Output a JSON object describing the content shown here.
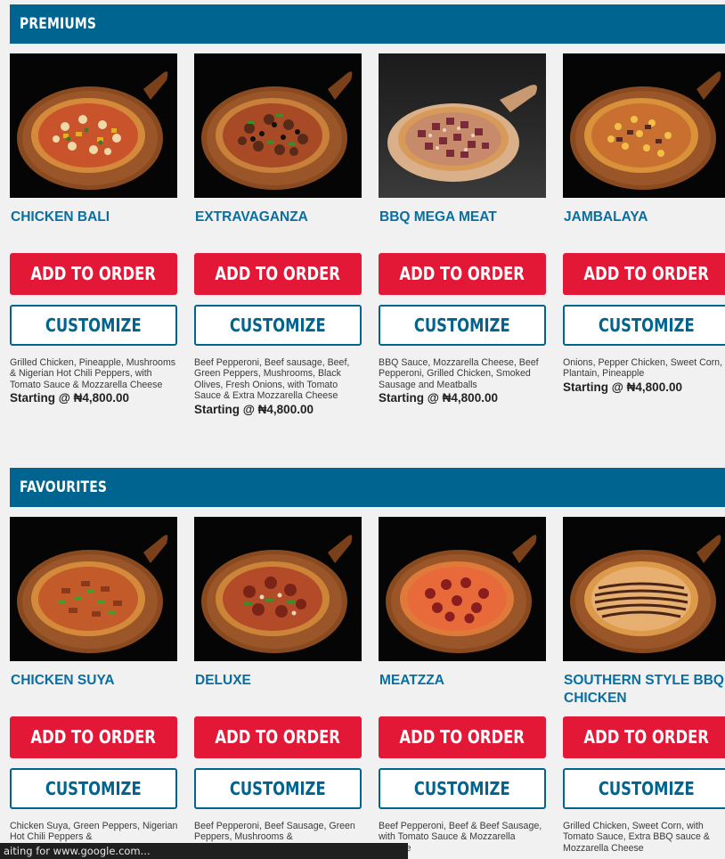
{
  "sections": [
    {
      "title": "PREMIUMS",
      "items": [
        {
          "name": "CHICKEN BALI",
          "add_label": "ADD TO ORDER",
          "customize_label": "CUSTOMIZE",
          "description": "Grilled Chicken, Pineapple, Mushrooms & Nigerian Hot Chili Peppers, with Tomato Sauce & Mozzarella Cheese",
          "price": "Starting @ ₦4,800.00"
        },
        {
          "name": "EXTRAVAGANZA",
          "add_label": "ADD TO ORDER",
          "customize_label": "CUSTOMIZE",
          "description": "Beef Pepperoni, Beef sausage, Beef, Green Peppers, Mushrooms, Black Olives, Fresh Onions, with Tomato Sauce & Extra Mozzarella Cheese",
          "price": "Starting @ ₦4,800.00"
        },
        {
          "name": "BBQ MEGA MEAT",
          "add_label": "ADD TO ORDER",
          "customize_label": "CUSTOMIZE",
          "description": "BBQ Sauce, Mozzarella Cheese, Beef Pepperoni, Grilled Chicken, Smoked Sausage and Meatballs",
          "price": "Starting @ ₦4,800.00"
        },
        {
          "name": "JAMBALAYA",
          "add_label": "ADD TO ORDER",
          "customize_label": "CUSTOMIZE",
          "description": "Onions, Pepper Chicken, Sweet Corn, Plantain, Pineapple",
          "price": "Starting @ ₦4,800.00"
        }
      ]
    },
    {
      "title": "FAVOURITES",
      "items": [
        {
          "name": "CHICKEN SUYA",
          "add_label": "ADD TO ORDER",
          "customize_label": "CUSTOMIZE",
          "description": "Chicken Suya, Green Peppers, Nigerian Hot Chili Peppers &",
          "price": ""
        },
        {
          "name": "DELUXE",
          "add_label": "ADD TO ORDER",
          "customize_label": "CUSTOMIZE",
          "description": "Beef Pepperoni, Beef Sausage, Green Peppers, Mushrooms &",
          "price": ""
        },
        {
          "name": "MEATZZA",
          "add_label": "ADD TO ORDER",
          "customize_label": "CUSTOMIZE",
          "description": "Beef Pepperoni, Beef & Beef Sausage, with Tomato Sauce & Mozzarella Cheese",
          "price": ""
        },
        {
          "name": "SOUTHERN STYLE BBQ CHICKEN",
          "add_label": "ADD TO ORDER",
          "customize_label": "CUSTOMIZE",
          "description": "Grilled Chicken, Sweet Corn, with Tomato Sauce, Extra BBQ sauce & Mozzarella Cheese",
          "price": ""
        }
      ]
    }
  ],
  "status_bar": {
    "text": "aiting for www.google.com..."
  },
  "colors": {
    "brand_blue": "#006491",
    "brand_red": "#e31837",
    "title_blue": "#0a6ea0"
  }
}
